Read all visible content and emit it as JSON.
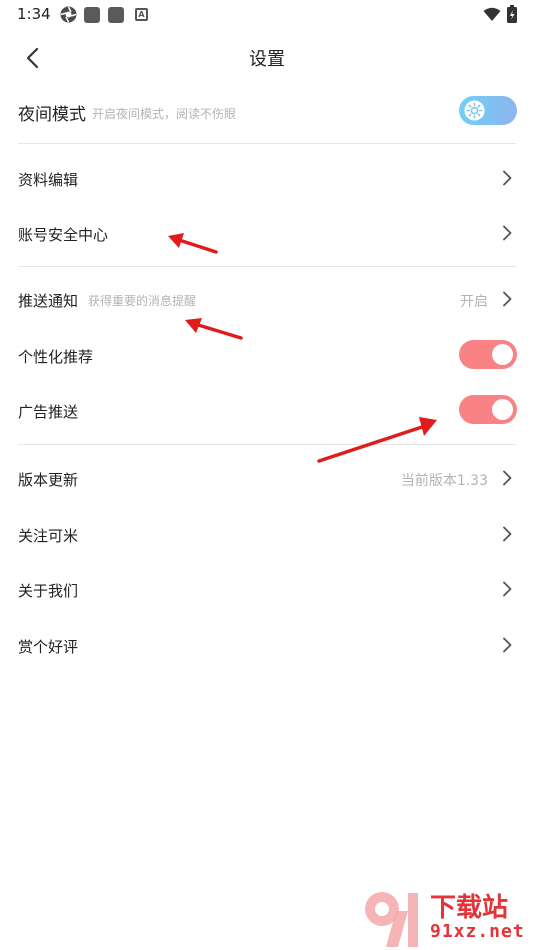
{
  "status_bar": {
    "time": "1:34"
  },
  "header": {
    "title": "设置"
  },
  "night_mode": {
    "label": "夜间模式",
    "subtitle": "开启夜间模式，阅读不伤眼"
  },
  "profile_edit": {
    "label": "资料编辑"
  },
  "account_security": {
    "label": "账号安全中心"
  },
  "push_notification": {
    "label": "推送通知",
    "subtitle": "获得重要的消息提醒",
    "value": "开启"
  },
  "personalized": {
    "label": "个性化推荐",
    "enabled": true
  },
  "ad_push": {
    "label": "广告推送",
    "enabled": true
  },
  "version_update": {
    "label": "版本更新",
    "value": "当前版本1.33"
  },
  "follow": {
    "label": "关注可米"
  },
  "about": {
    "label": "关于我们"
  },
  "rate": {
    "label": "赏个好评"
  },
  "watermark": {
    "title": "下载站",
    "url": "91xz.net",
    "logo_text": "91"
  },
  "colors": {
    "toggle_on": "#f88284",
    "night_toggle": "#7cc4f3",
    "arrow": "#e01b1b",
    "watermark": "#e5333a"
  }
}
